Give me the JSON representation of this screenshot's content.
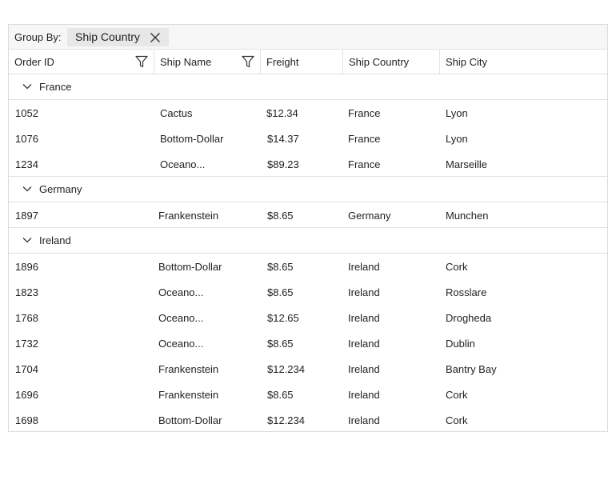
{
  "group_bar": {
    "label": "Group By:",
    "chip_label": "Ship Country"
  },
  "columns": {
    "order_id": "Order ID",
    "ship_name": "Ship Name",
    "freight": "Freight",
    "ship_country": "Ship Country",
    "ship_city": "Ship City"
  },
  "groups": [
    {
      "label": "France",
      "rows": [
        {
          "order_id": "1052",
          "ship_name": "Cactus",
          "freight": "$12.34",
          "ship_country": "France",
          "ship_city": "Lyon"
        },
        {
          "order_id": "1076",
          "ship_name": "Bottom-Dollar",
          "freight": "$14.37",
          "ship_country": "France",
          "ship_city": "Lyon"
        },
        {
          "order_id": "1234",
          "ship_name": "Oceano...",
          "freight": "$89.23",
          "ship_country": "France",
          "ship_city": "Marseille"
        }
      ]
    },
    {
      "label": "Germany",
      "rows": [
        {
          "order_id": "1897",
          "ship_name": "Frankenstein",
          "freight": "$8.65",
          "ship_country": "Germany",
          "ship_city": "Munchen"
        }
      ]
    },
    {
      "label": "Ireland",
      "rows": [
        {
          "order_id": "1896",
          "ship_name": "Bottom-Dollar",
          "freight": "$8.65",
          "ship_country": "Ireland",
          "ship_city": "Cork"
        },
        {
          "order_id": "1823",
          "ship_name": "Oceano...",
          "freight": "$8.65",
          "ship_country": "Ireland",
          "ship_city": "Rosslare"
        },
        {
          "order_id": "1768",
          "ship_name": "Oceano...",
          "freight": "$12.65",
          "ship_country": "Ireland",
          "ship_city": "Drogheda"
        },
        {
          "order_id": "1732",
          "ship_name": "Oceano...",
          "freight": "$8.65",
          "ship_country": "Ireland",
          "ship_city": "Dublin"
        },
        {
          "order_id": "1704",
          "ship_name": "Frankenstein",
          "freight": "$12.234",
          "ship_country": "Ireland",
          "ship_city": "Bantry Bay"
        },
        {
          "order_id": "1696",
          "ship_name": "Frankenstein",
          "freight": "$8.65",
          "ship_country": "Ireland",
          "ship_city": "Cork"
        },
        {
          "order_id": "1698",
          "ship_name": "Bottom-Dollar",
          "freight": "$12.234",
          "ship_country": "Ireland",
          "ship_city": "Cork"
        }
      ]
    }
  ]
}
